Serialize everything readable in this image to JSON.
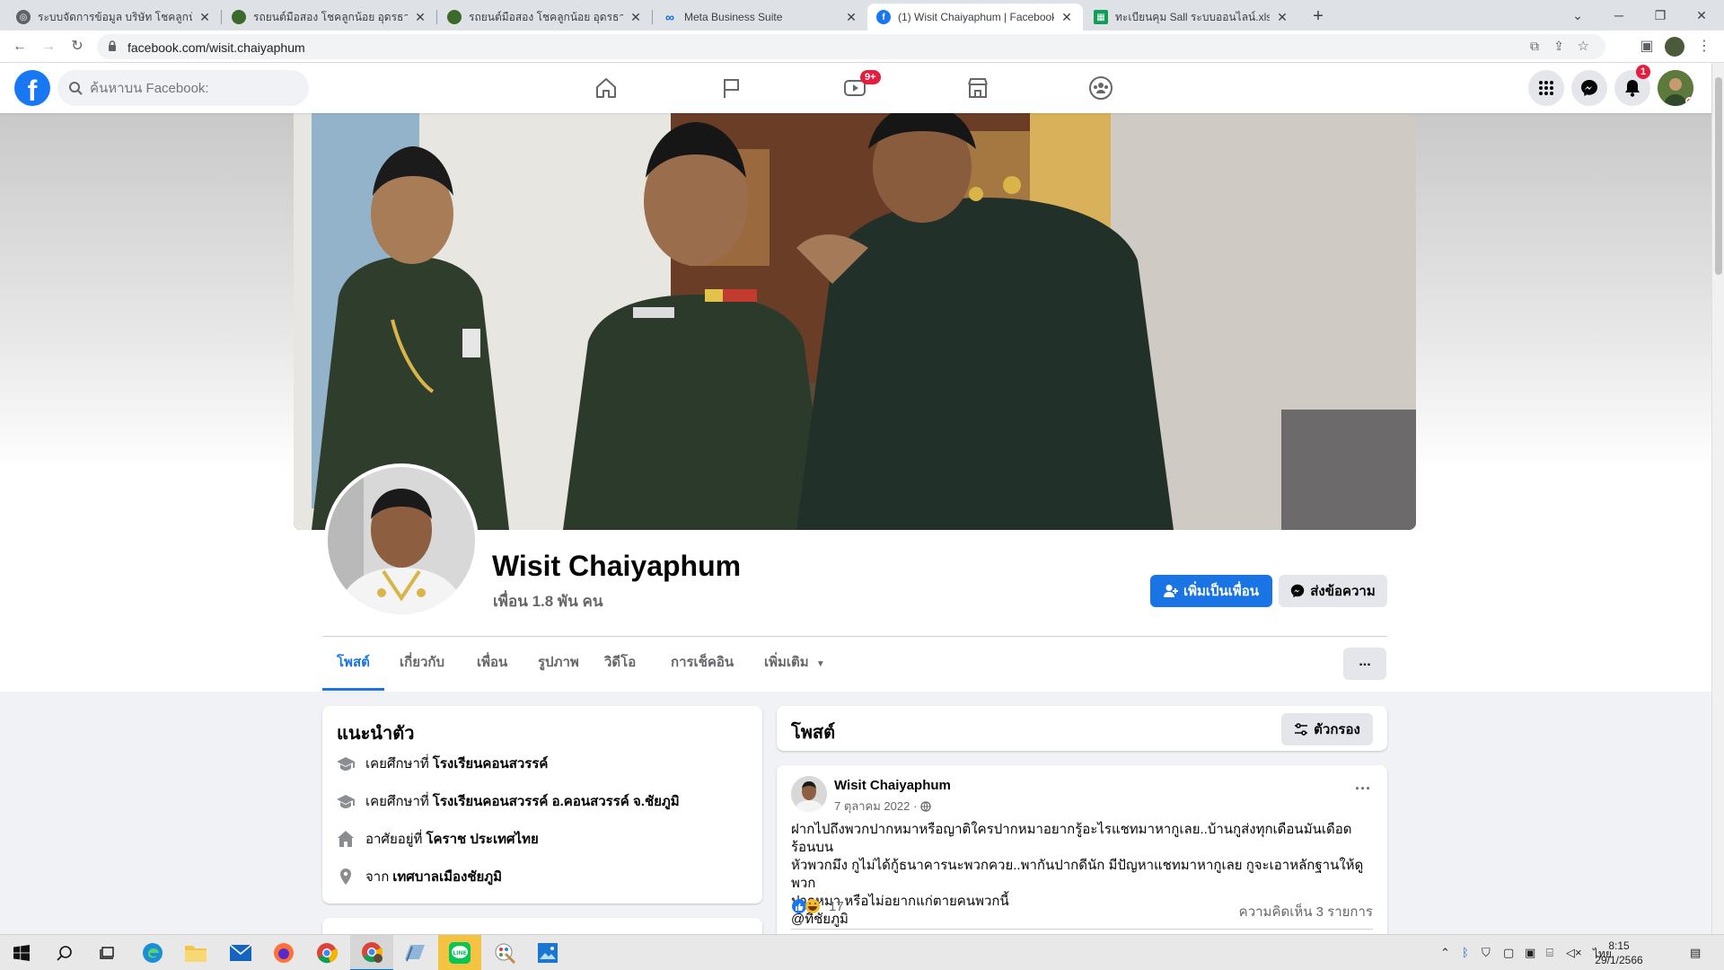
{
  "browser": {
    "tabs": [
      {
        "title": "ระบบจัดการข้อมูล บริษัท โชคลูกน้อย อ",
        "favicon": "globe-icon",
        "active": false
      },
      {
        "title": "รถยนต์มือสอง โชคลูกน้อย อุดรธานี",
        "favicon": "site-logo-icon",
        "active": false
      },
      {
        "title": "รถยนต์มือสอง โชคลูกน้อย อุดรธานี",
        "favicon": "site-logo-icon",
        "active": false
      },
      {
        "title": "Meta Business Suite",
        "favicon": "meta-icon",
        "active": false
      },
      {
        "title": "(1) Wisit Chaiyaphum | Facebook",
        "favicon": "facebook-icon",
        "active": true
      },
      {
        "title": "ทะเบียนคุม Sall ระบบออนไลน์.xlsx - G",
        "favicon": "sheets-icon",
        "active": false
      }
    ],
    "url": "facebook.com/wisit.chaiyaphum"
  },
  "fb": {
    "search_placeholder": "ค้นหาบน Facebook:",
    "video_badge": "9+",
    "notif_badge": "1"
  },
  "profile": {
    "name": "Wisit Chaiyaphum",
    "friends": "เพื่อน 1.8 พัน คน",
    "add_friend": "เพิ่มเป็นเพื่อน",
    "message": "ส่งข้อความ",
    "tabs": [
      "โพสต์",
      "เกี่ยวกับ",
      "เพื่อน",
      "รูปภาพ",
      "วิดีโอ",
      "การเช็คอิน",
      "เพิ่มเติม"
    ],
    "more_btn": "..."
  },
  "intro": {
    "title": "แนะนำตัว",
    "items": [
      {
        "prefix": "เคยศึกษาที่",
        "bold": "โรงเรียนคอนสวรรค์",
        "icon": "school-icon"
      },
      {
        "prefix": "เคยศึกษาที่",
        "bold": "โรงเรียนคอนสวรรค์ อ.คอนสวรรค์ จ.ชัยภูมิ",
        "icon": "school-icon"
      },
      {
        "prefix": "อาศัยอยู่ที่",
        "bold": "โคราช ประเทศไทย",
        "icon": "home-icon"
      },
      {
        "prefix": "จาก",
        "bold": "เทศบาลเมืองชัยภูมิ",
        "icon": "location-pin-icon"
      }
    ]
  },
  "posts": {
    "title": "โพสต์",
    "filter": "ตัวกรอง",
    "post": {
      "author": "Wisit Chaiyaphum",
      "date": "7 ตุลาคม 2022 ·",
      "lines": [
        "ฝากไปถึงพวกปากหมาหรือญาติใครปากหมาอยากรู้อะไรแชทมาหากูเลย..บ้านกูส่งทุกเดือนมันเดือดร้อนบน",
        "หัวพวกมึง กูไม่ได้กู้ธนาคารนะพวกควย..พากันปากดีนัก  มีปัญหาแชทมาหากูเลย กูจะเอาหลักฐานให้ดู  พวก",
        "ปากหมา หรือไม่อยากแก่ตายคนพวกนี้",
        "@ที่ชัยภูมิ"
      ],
      "reactions": "17",
      "comments": "ความคิดเห็น 3 รายการ"
    }
  },
  "taskbar": {
    "lang": "ไทย",
    "time": "8:15",
    "date": "29/1/2566"
  },
  "colors": {
    "fb_blue": "#1877f2",
    "button_blue": "#1b74e4",
    "badge_red": "#e41e3f"
  }
}
